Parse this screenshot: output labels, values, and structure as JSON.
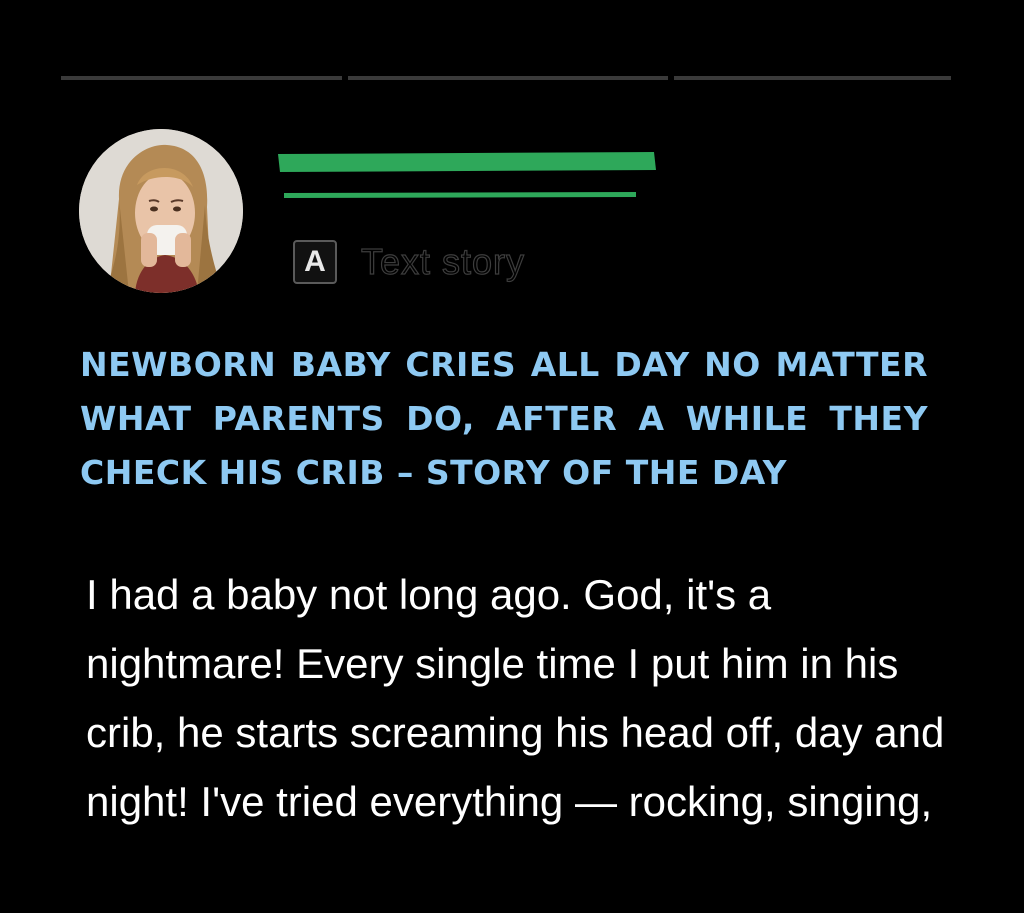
{
  "story": {
    "type_icon_letter": "A",
    "type_label": "Text story",
    "author_name_redacted": true,
    "progress_segments": 3,
    "active_segment": 0
  },
  "avatar": {
    "icon": "woman-crying-photo"
  },
  "headline": "NEWBORN BABY CRIES ALL DAY NO MATTER WHAT PARENTS DO, AFTER A WHILE THEY CHECK HIS CRIB – STORY OF THE DAY",
  "body": "I had a baby not long ago. God, it's a nightmare! Every single time I put him in his crib, he starts screaming his head off, day and night! I've tried everything — rocking, singing,",
  "colors": {
    "background": "#000000",
    "headline": "#8ec9f2",
    "redaction": "#2ea85a",
    "progress_track": "#3a3a3a",
    "body_text": "#ffffff"
  }
}
